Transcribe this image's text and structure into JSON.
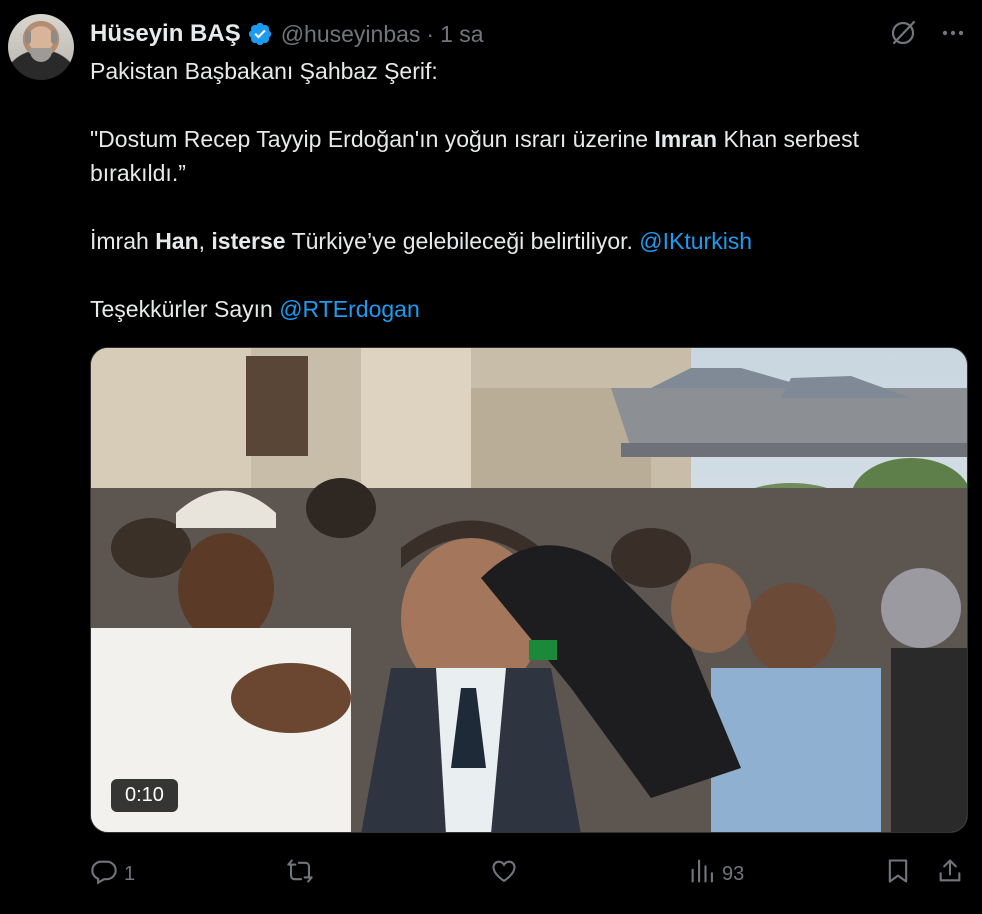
{
  "author": {
    "name": "Hüseyin BAŞ",
    "handle": "@huseyinbas",
    "separator": "·",
    "time": "1 sa"
  },
  "tweet": {
    "line1": "Pakistan Başbakanı Şahbaz Şerif:",
    "quote_a": "\"Dostum Recep Tayyip Erdoğan'ın yoğun ısrarı üzerine ",
    "quote_bold": "Imran",
    "quote_b": " Khan serbest bırakıldı.”",
    "p3_a": "İmrah ",
    "p3_bold1": "Han",
    "p3_comma": ", ",
    "p3_bold2": "isterse",
    "p3_b": " Türkiye’ye gelebileceği belirtiliyor. ",
    "p3_mention": "@IKturkish",
    "p4_a": "Teşekkürler Sayın ",
    "p4_mention": "@RTErdogan"
  },
  "media": {
    "type": "video",
    "duration": "0:10"
  },
  "actions": {
    "reply_count": "1",
    "retweet_count": "",
    "like_count": "",
    "views_count": "93"
  },
  "colors": {
    "background": "#000000",
    "text": "#e7e9ea",
    "muted": "#71767b",
    "accent": "#1d9bf0"
  }
}
